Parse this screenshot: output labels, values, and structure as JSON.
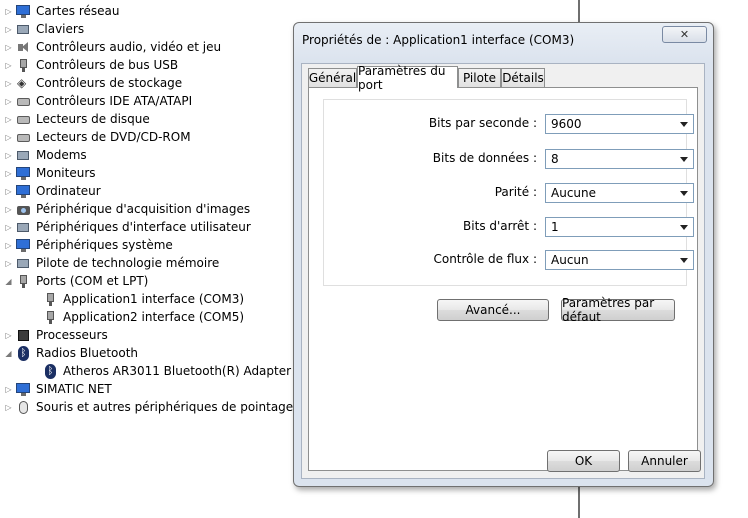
{
  "device_tree": [
    {
      "label": "Cartes réseau",
      "expander": "collapsed",
      "level": 0,
      "icon": "network-adapter-icon"
    },
    {
      "label": "Claviers",
      "expander": "collapsed",
      "level": 0,
      "icon": "keyboard-icon"
    },
    {
      "label": "Contrôleurs audio, vidéo et jeu",
      "expander": "collapsed",
      "level": 0,
      "icon": "speaker-icon"
    },
    {
      "label": "Contrôleurs de bus USB",
      "expander": "collapsed",
      "level": 0,
      "icon": "usb-icon"
    },
    {
      "label": "Contrôleurs de stockage",
      "expander": "collapsed",
      "level": 0,
      "icon": "storage-controller-icon"
    },
    {
      "label": "Contrôleurs IDE ATA/ATAPI",
      "expander": "collapsed",
      "level": 0,
      "icon": "ide-controller-icon"
    },
    {
      "label": "Lecteurs de disque",
      "expander": "collapsed",
      "level": 0,
      "icon": "disk-drive-icon"
    },
    {
      "label": "Lecteurs de DVD/CD-ROM",
      "expander": "collapsed",
      "level": 0,
      "icon": "dvd-drive-icon"
    },
    {
      "label": "Modems",
      "expander": "collapsed",
      "level": 0,
      "icon": "modem-icon"
    },
    {
      "label": "Moniteurs",
      "expander": "collapsed",
      "level": 0,
      "icon": "monitor-icon"
    },
    {
      "label": "Ordinateur",
      "expander": "collapsed",
      "level": 0,
      "icon": "computer-icon"
    },
    {
      "label": "Périphérique d'acquisition d'images",
      "expander": "collapsed",
      "level": 0,
      "icon": "camera-icon"
    },
    {
      "label": "Périphériques d'interface utilisateur",
      "expander": "collapsed",
      "level": 0,
      "icon": "hid-icon"
    },
    {
      "label": "Périphériques système",
      "expander": "collapsed",
      "level": 0,
      "icon": "system-device-icon"
    },
    {
      "label": "Pilote de technologie mémoire",
      "expander": "collapsed",
      "level": 0,
      "icon": "memory-driver-icon"
    },
    {
      "label": "Ports (COM et LPT)",
      "expander": "expanded",
      "level": 0,
      "icon": "port-icon"
    },
    {
      "label": "Application1 interface (COM3)",
      "expander": "none",
      "level": 1,
      "icon": "port-icon"
    },
    {
      "label": "Application2 interface (COM5)",
      "expander": "none",
      "level": 1,
      "icon": "port-icon"
    },
    {
      "label": "Processeurs",
      "expander": "collapsed",
      "level": 0,
      "icon": "processor-icon"
    },
    {
      "label": "Radios Bluetooth",
      "expander": "expanded",
      "level": 0,
      "icon": "bluetooth-icon"
    },
    {
      "label": "Atheros AR3011 Bluetooth(R) Adapter",
      "expander": "none",
      "level": 1,
      "icon": "bluetooth-icon"
    },
    {
      "label": "SIMATIC NET",
      "expander": "collapsed",
      "level": 0,
      "icon": "network-icon"
    },
    {
      "label": "Souris et autres périphériques de pointage",
      "expander": "collapsed",
      "level": 0,
      "icon": "mouse-icon"
    }
  ],
  "dialog": {
    "title": "Propriétés de : Application1 interface (COM3)",
    "close_glyph": "✕",
    "tabs": [
      {
        "label": "Général",
        "active": false
      },
      {
        "label": "Paramètres du port",
        "active": true
      },
      {
        "label": "Pilote",
        "active": false
      },
      {
        "label": "Détails",
        "active": false
      }
    ],
    "fields": [
      {
        "label": "Bits par seconde :",
        "value": "9600"
      },
      {
        "label": "Bits de données :",
        "value": "8"
      },
      {
        "label": "Parité :",
        "value": "Aucune"
      },
      {
        "label": "Bits d'arrêt :",
        "value": "1"
      },
      {
        "label": "Contrôle de flux :",
        "value": "Aucun"
      }
    ],
    "buttons": {
      "advanced": "Avancé...",
      "defaults": "Paramètres par défaut",
      "ok": "OK",
      "cancel": "Annuler"
    }
  }
}
